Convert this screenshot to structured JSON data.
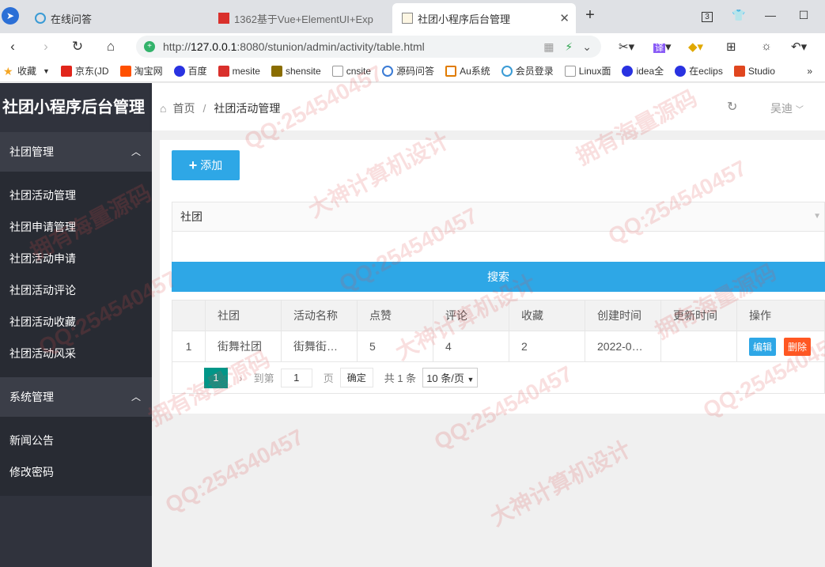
{
  "browser": {
    "tabs": [
      {
        "title": "在线问答"
      },
      {
        "title": "1362基于Vue+ElementUI+Exp"
      },
      {
        "title": "社团小程序后台管理"
      }
    ],
    "url_scheme": "http://",
    "url_host": "127.0.0.1",
    "url_path": ":8080/stunion/admin/activity/table.html",
    "tab_count_badge": "3",
    "translate_label": "译",
    "bookmarks": [
      {
        "label": "收藏",
        "color": "#f5a623"
      },
      {
        "label": "京东(JD",
        "color": "#e1251b"
      },
      {
        "label": "淘宝网",
        "color": "#ff5000"
      },
      {
        "label": "百度",
        "color": "#2932e1"
      },
      {
        "label": "mesite",
        "color": "#d9302c"
      },
      {
        "label": "shensite",
        "color": "#8a6d00"
      },
      {
        "label": "cnsite",
        "color": "#999999"
      },
      {
        "label": "源码问答",
        "color": "#3a7bd5"
      },
      {
        "label": "Au系统",
        "color": "#e07b00"
      },
      {
        "label": "会员登录",
        "color": "#3a9bd5"
      },
      {
        "label": "Linux面",
        "color": "#999999"
      },
      {
        "label": "idea全",
        "color": "#2932e1"
      },
      {
        "label": "在eclips",
        "color": "#2932e1"
      },
      {
        "label": "Studio",
        "color": "#e0461f"
      }
    ]
  },
  "app": {
    "title": "社团小程序后台管理",
    "sidebar": {
      "groups": [
        {
          "label": "社团管理",
          "items": [
            "社团活动管理",
            "社团申请管理",
            "社团活动申请",
            "社团活动评论",
            "社团活动收藏",
            "社团活动风采"
          ]
        },
        {
          "label": "系统管理",
          "items": [
            "新闻公告",
            "修改密码"
          ]
        }
      ]
    },
    "header": {
      "breadcrumb_home": "首页",
      "breadcrumb_sep": "/",
      "breadcrumb_current": "社团活动管理",
      "user": "吴迪"
    },
    "toolbar": {
      "add_label": "添加"
    },
    "filter": {
      "select_value": "社团",
      "search_label": "搜索"
    },
    "table": {
      "columns": [
        "",
        "社团",
        "活动名称",
        "点赞",
        "评论",
        "收藏",
        "创建时间",
        "更新时间",
        "操作"
      ],
      "rows": [
        {
          "idx": "1",
          "club": "街舞社团",
          "name": "街舞街…",
          "likes": "5",
          "comments": "4",
          "favorites": "2",
          "created": "2022-0…",
          "updated": ""
        }
      ],
      "edit_label": "编辑",
      "delete_label": "删除"
    },
    "pager": {
      "current": "1",
      "goto_label": "到第",
      "page_input": "1",
      "page_unit": "页",
      "confirm": "确定",
      "total": "共 1 条",
      "page_size": "10 条/页"
    }
  },
  "watermarks": [
    "QQ:254540457",
    "大神计算机设计",
    "拥有海量源码"
  ]
}
